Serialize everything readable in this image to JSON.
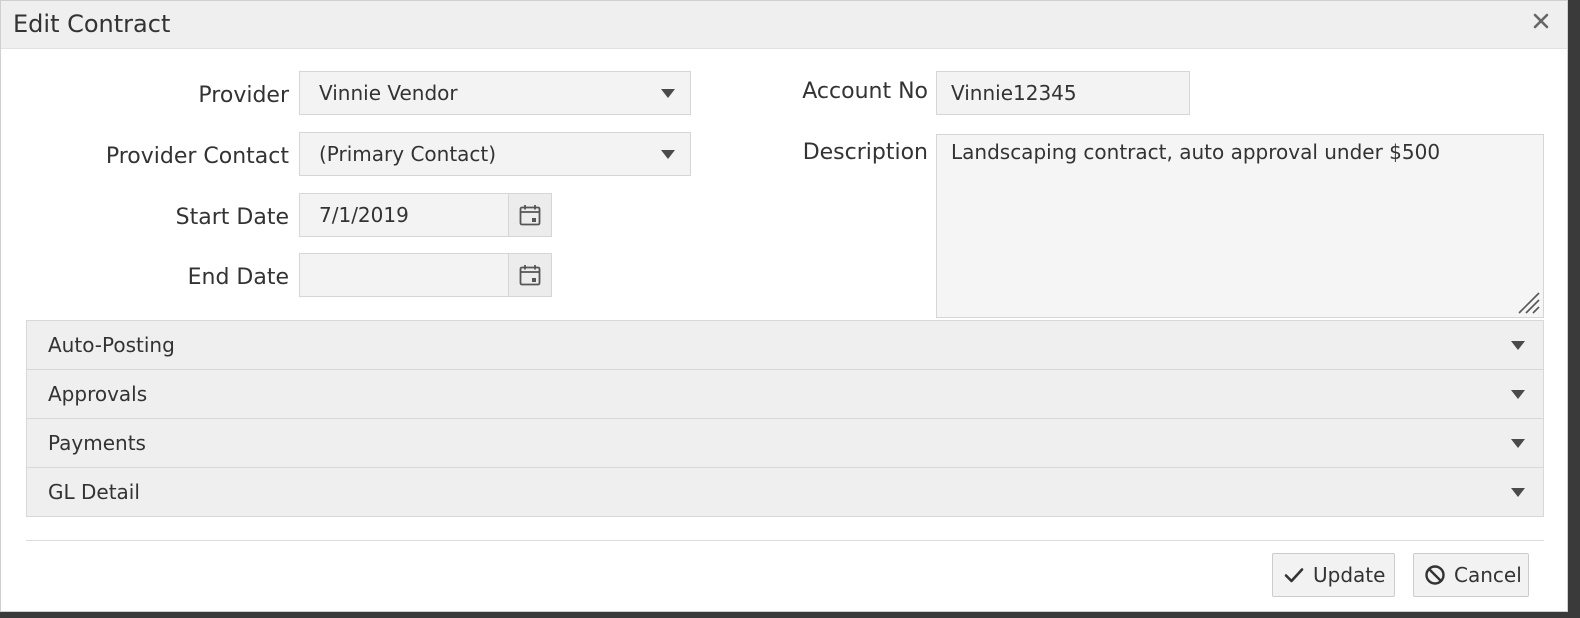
{
  "dialog": {
    "title": "Edit Contract"
  },
  "form": {
    "provider": {
      "label": "Provider",
      "value": "Vinnie Vendor"
    },
    "provider_contact": {
      "label": "Provider Contact",
      "value": "(Primary Contact)"
    },
    "start_date": {
      "label": "Start Date",
      "value": "7/1/2019"
    },
    "end_date": {
      "label": "End Date",
      "value": ""
    },
    "account_no": {
      "label": "Account No",
      "value": "Vinnie12345"
    },
    "description": {
      "label": "Description",
      "value": "Landscaping contract, auto approval under $500"
    }
  },
  "sections": [
    {
      "label": "Auto-Posting"
    },
    {
      "label": "Approvals"
    },
    {
      "label": "Payments"
    },
    {
      "label": "GL Detail"
    }
  ],
  "buttons": {
    "update": "Update",
    "cancel": "Cancel"
  },
  "icons": {
    "close": "close-icon",
    "calendar": "calendar-icon",
    "caret": "chevron-down-icon",
    "check": "check-icon",
    "cancel": "ban-icon"
  }
}
